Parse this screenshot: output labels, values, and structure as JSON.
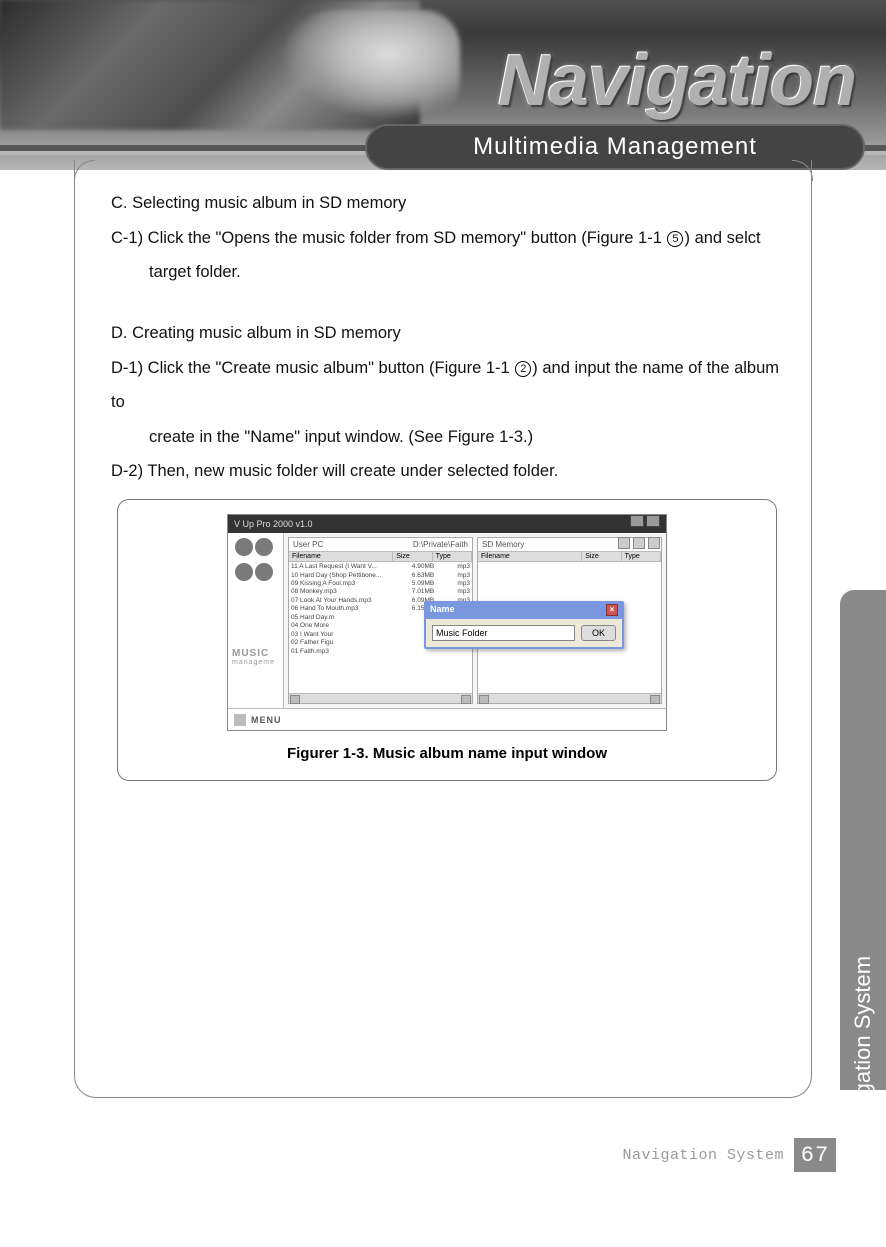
{
  "header": {
    "brand_word": "Navigation",
    "section_title": "Multimedia Management"
  },
  "content": {
    "c_heading": "C. Selecting music album in SD memory",
    "c1_line1": "C-1) Click the \"Opens the music folder from SD memory\" button (Figure 1-1 ",
    "c1_circle": "5",
    "c1_line2": ") and selct",
    "c1_indent": "target folder.",
    "d_heading": "D. Creating music album in SD memory",
    "d1_line1": "D-1) Click the \"Create music album\" button (Figure 1-1 ",
    "d1_circle": "2",
    "d1_line2": ") and input the name of the album to",
    "d1_indent": "create in the \"Name\" input window. (See Figure 1-3.)",
    "d2": "D-2) Then, new music folder will create under selected folder."
  },
  "figure": {
    "caption": "Figurer 1-3. Music album name input window",
    "app_title": "V Up Pro 2000  v1.0",
    "left_panel_title": "User PC",
    "left_panel_path": "D:\\Private\\Faith",
    "right_panel_title": "SD Memory",
    "col_filename": "Filename",
    "col_size": "Size",
    "col_type": "Type",
    "side_logo_text": "MUSIC",
    "side_logo_sub": "manageme",
    "menu_label": "MENU",
    "dialog_title": "Name",
    "dialog_value": "Music Folder",
    "dialog_ok": "OK",
    "file_rows": [
      {
        "name": "11 A Last Request (I Want V...",
        "size": "4.90MB",
        "type": "mp3"
      },
      {
        "name": "10 Hard Day (Shop Pettibone...",
        "size": "6.63MB",
        "type": "mp3"
      },
      {
        "name": "09 Kissing A Fool.mp3",
        "size": "5.09MB",
        "type": "mp3"
      },
      {
        "name": "08 Monkey.mp3",
        "size": "7.01MB",
        "type": "mp3"
      },
      {
        "name": "07 Look At Your Hands.mp3",
        "size": "6.09MB",
        "type": "mp3"
      },
      {
        "name": "06 Hand To Mouth.mp3",
        "size": "6.15MB",
        "type": "mp3"
      },
      {
        "name": "05 Hard Day.m",
        "size": "",
        "type": ""
      },
      {
        "name": "04 One More",
        "size": "",
        "type": ""
      },
      {
        "name": "03 I Want Your",
        "size": "",
        "type": ""
      },
      {
        "name": "02 Father Figu",
        "size": "",
        "type": ""
      },
      {
        "name": "01 Faith.mp3",
        "size": "",
        "type": ""
      }
    ]
  },
  "side_tab": "Upgrading Navigation System",
  "footer": {
    "label": "Navigation System",
    "page": "67"
  }
}
